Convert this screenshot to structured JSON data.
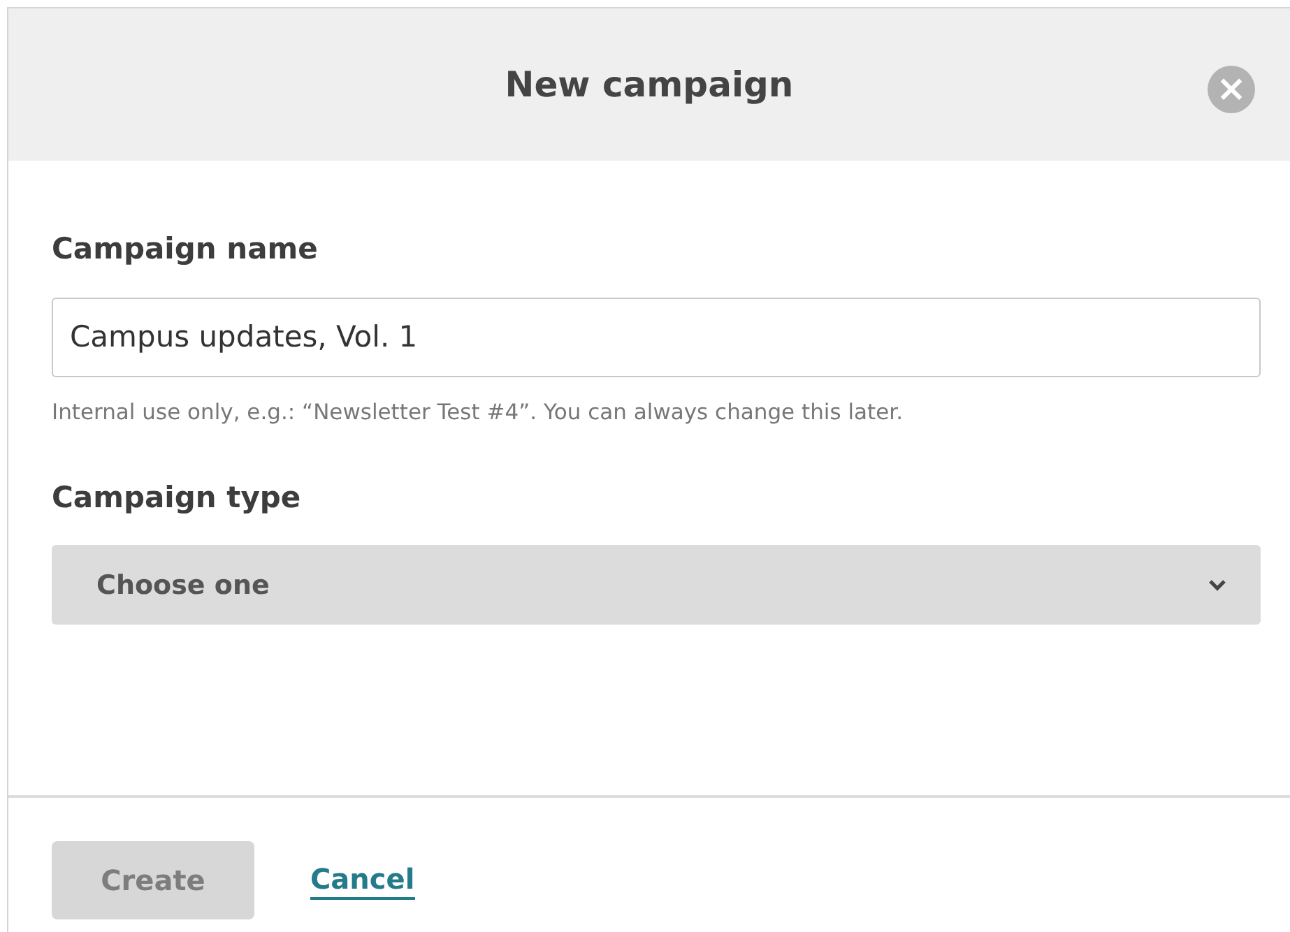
{
  "dialog": {
    "title": "New campaign",
    "close": "×"
  },
  "fields": [
    {
      "kind": "text",
      "label": "Campaign name",
      "value": "Campus updates, Vol. 1",
      "help": "Internal use only, e.g.: “Newsletter Test #4”. You can always change this later."
    },
    {
      "kind": "select",
      "label": "Campaign type",
      "value": "Choose one"
    }
  ],
  "footer": {
    "create": {
      "label": "Create",
      "disabled": true
    },
    "cancel": "Cancel"
  }
}
